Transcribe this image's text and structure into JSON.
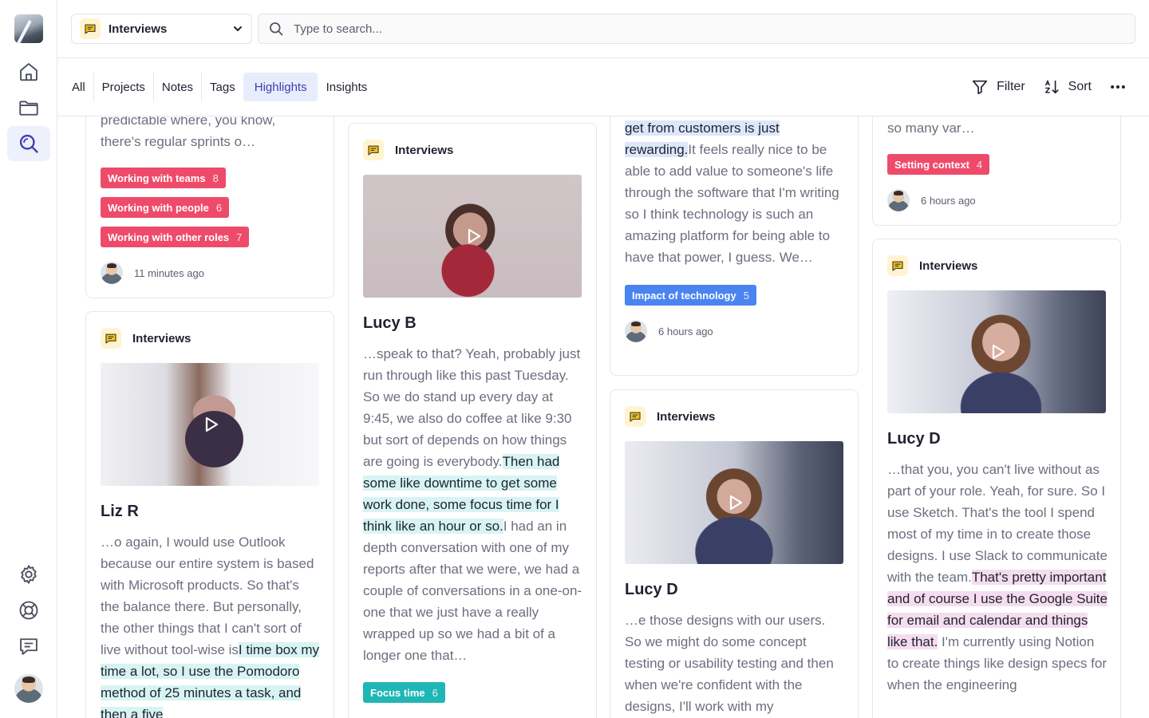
{
  "colors": {
    "accent": "#3d3fb3",
    "tag_red": "#ee4b6a",
    "tag_blue": "#4a84f0",
    "tag_teal": "#1fb7b5",
    "highlight_teal": "#d7f4f3",
    "highlight_blue": "#dde7fb",
    "highlight_pink": "#f5dcef"
  },
  "sidebar": {
    "items": [
      {
        "name": "home",
        "icon": "home-icon"
      },
      {
        "name": "projects",
        "icon": "folder-icon"
      },
      {
        "name": "search",
        "icon": "search-icon",
        "active": true
      },
      {
        "name": "settings",
        "icon": "gear-icon"
      },
      {
        "name": "help",
        "icon": "lifebuoy-icon"
      },
      {
        "name": "feedback",
        "icon": "chat-icon"
      }
    ]
  },
  "header": {
    "space_label": "Interviews",
    "search_placeholder": "Type to search..."
  },
  "tabs": [
    {
      "label": "All"
    },
    {
      "label": "Projects"
    },
    {
      "label": "Notes"
    },
    {
      "label": "Tags"
    },
    {
      "label": "Highlights",
      "active": true
    },
    {
      "label": "Insights"
    }
  ],
  "toolbar": {
    "filter_label": "Filter",
    "sort_label": "Sort"
  },
  "cards": {
    "c1": {
      "quote": "predictable where, you know, there's regular sprints o…",
      "tags": [
        {
          "label": "Working with teams",
          "count": "8"
        },
        {
          "label": "Working with people",
          "count": "6"
        },
        {
          "label": "Working with other roles",
          "count": "7"
        }
      ],
      "time": "11 minutes ago"
    },
    "c2": {
      "source": "Interviews",
      "person": "Liz R",
      "quote_before": "…o again, I would use Outlook because our entire system is based with Microsoft products. So that's the balance there. But personally, the other things that I can't sort of live without tool-wise is",
      "quote_highlight": "I time box my time a lot, so I use the Pomodoro method of 25 minutes a task, and then a five"
    },
    "c3": {
      "source": "Interviews",
      "person": "Lucy B",
      "quote_before": "…speak to that? Yeah, probably just run through like this past Tuesday. So we do stand up every day at 9:45, we also do coffee at like 9:30 but sort of depends on how things are going is everybody.",
      "quote_highlight": "Then had some like downtime to get some work done, some focus time for I think like an hour or so.",
      "quote_after": "I had an in depth conversation with one of my reports after that we were, we had a couple of conversations in a one-on-one that we just have a really wrapped up so we had a bit of a longer one that…",
      "tag": {
        "label": "Focus time",
        "count": "6"
      }
    },
    "c4": {
      "quote_highlight": "get from customers is just rewarding.",
      "quote_after": "It feels really nice to be able to add value to someone's life through the software that I'm writing so I think technology is such an amazing platform for being able to have that power, I guess. We…",
      "tag": {
        "label": "Impact of technology",
        "count": "5"
      },
      "time": "6 hours ago"
    },
    "c5": {
      "source": "Interviews",
      "person": "Lucy D",
      "quote": "…e those designs with our users. So we might do some concept testing or usability testing and then when we're confident with the designs, I'll work with my"
    },
    "c6": {
      "quote": "so many var…",
      "tag": {
        "label": "Setting context",
        "count": "4"
      },
      "time": "6 hours ago"
    },
    "c7": {
      "source": "Interviews",
      "person": "Lucy D",
      "quote_before": "…that you, you can't live without as part of your role. Yeah, for sure. So I use Sketch. That's the tool I spend most of my time in to create those designs. I use Slack to communicate with the team.",
      "quote_highlight": "That's pretty important and of course I use the Google Suite for email and calendar and things like that.",
      "quote_after": " I'm currently using Notion to create things like design specs for when the engineering"
    }
  }
}
